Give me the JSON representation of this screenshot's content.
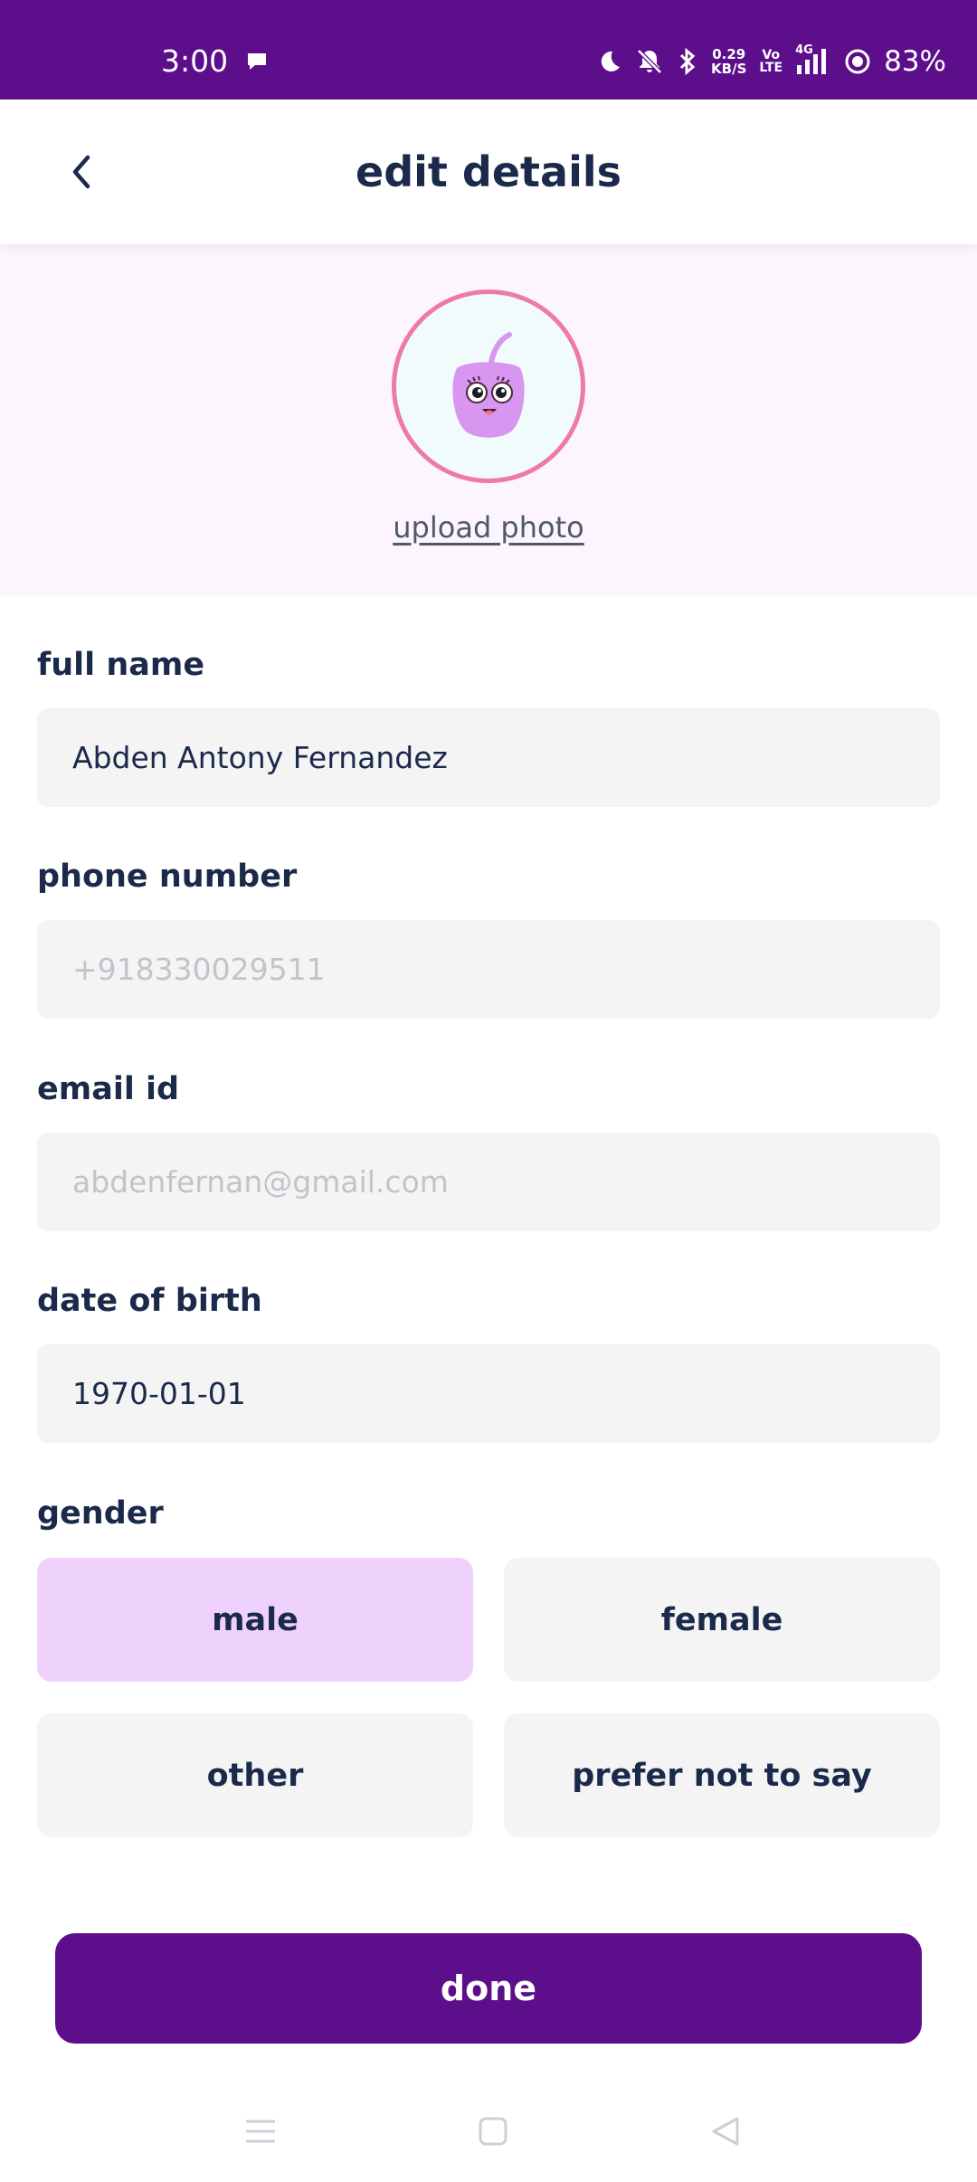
{
  "status_bar": {
    "time": "3:00",
    "net_speed_value": "0.29",
    "net_speed_unit": "KB/S",
    "volte_top": "Vo",
    "volte_bottom": "LTE",
    "network_type": "4G",
    "battery": "83%"
  },
  "header": {
    "title": "edit details"
  },
  "profile": {
    "upload_label": "upload photo"
  },
  "form": {
    "full_name": {
      "label": "full name",
      "value": "Abden Antony Fernandez"
    },
    "phone": {
      "label": "phone number",
      "value": "+918330029511"
    },
    "email": {
      "label": "email id",
      "value": "abdenfernan@gmail.com"
    },
    "dob": {
      "label": "date of birth",
      "value": "1970-01-01"
    },
    "gender": {
      "label": "gender",
      "options": [
        "male",
        "female",
        "other",
        "prefer not to say"
      ],
      "selected": "male"
    }
  },
  "actions": {
    "done_label": "done"
  },
  "colors": {
    "primary": "#5c0e8b",
    "selected_option": "#efd2fc",
    "avatar_ring": "#ee7aa8",
    "field_bg": "#f4f4f5"
  }
}
